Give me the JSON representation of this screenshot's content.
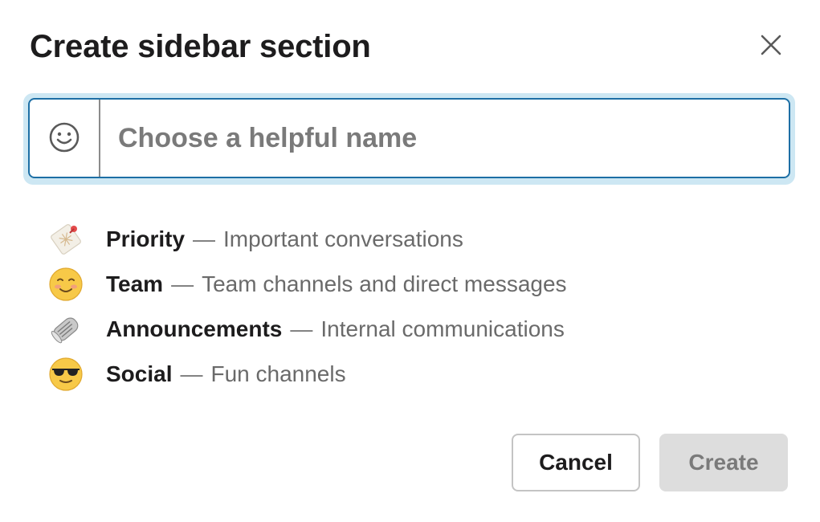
{
  "dialog": {
    "title": "Create sidebar section",
    "close_icon": "close-icon"
  },
  "name_field": {
    "placeholder": "Choose a helpful name",
    "value": "",
    "emoji_icon": "smiley-face-icon"
  },
  "suggestions": [
    {
      "emoji": "bookmark-tabs-icon",
      "name": "Priority",
      "separator": "—",
      "description": "Important conversations"
    },
    {
      "emoji": "smiling-face-icon",
      "name": "Team",
      "separator": "—",
      "description": "Team channels and direct messages"
    },
    {
      "emoji": "rolled-newspaper-icon",
      "name": "Announcements",
      "separator": "—",
      "description": "Internal communications"
    },
    {
      "emoji": "sunglasses-face-icon",
      "name": "Social",
      "separator": "—",
      "description": "Fun channels"
    }
  ],
  "footer": {
    "cancel_label": "Cancel",
    "create_label": "Create"
  },
  "colors": {
    "focus_ring": "#cde7f3",
    "focus_border": "#1d6fa5",
    "disabled_button": "#dddddd",
    "text_primary": "#1d1c1d",
    "text_muted": "#6a6a6a"
  }
}
